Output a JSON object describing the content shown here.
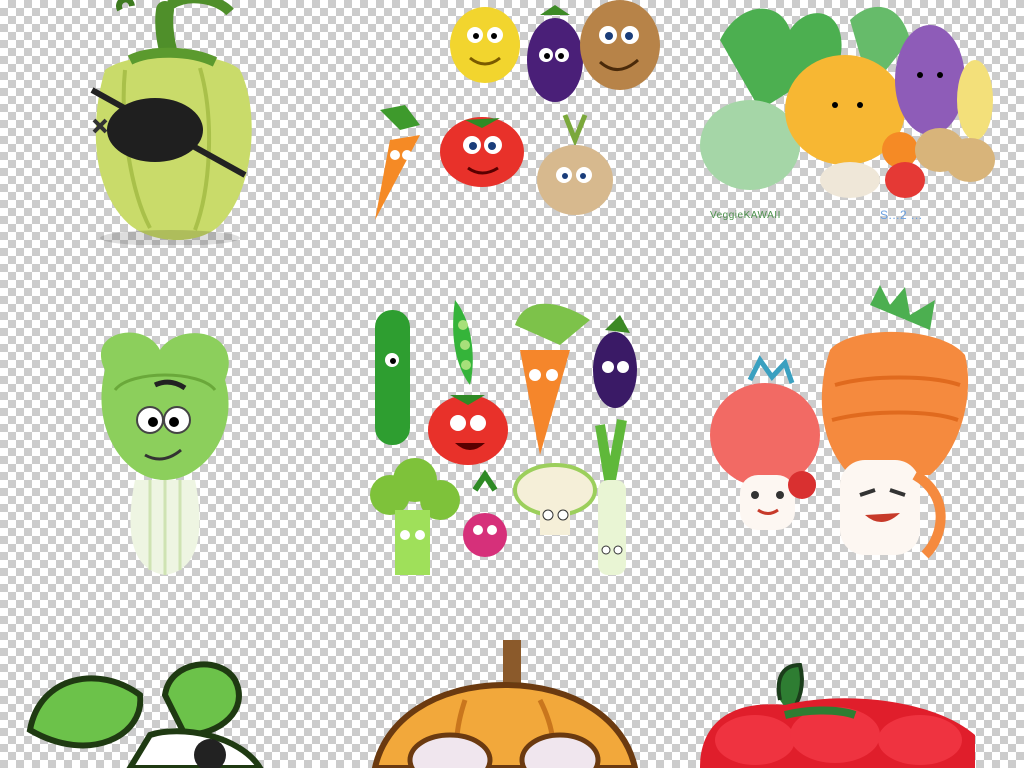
{
  "collage": {
    "items": [
      {
        "icon": "pirate-bell-pepper-icon"
      },
      {
        "icon": "vegetable-friends-group-icon"
      },
      {
        "icon": "kawaii-vegetable-pile-icon"
      },
      {
        "icon": "bok-choy-character-icon"
      },
      {
        "icon": "vegetable-characters-set-icon"
      },
      {
        "icon": "radish-carrot-characters-icon"
      },
      {
        "icon": "green-leaf-character-icon"
      },
      {
        "icon": "pumpkin-character-icon"
      },
      {
        "icon": "red-pepper-character-icon"
      }
    ],
    "watermark_left": "VeggieKAWAII",
    "watermark_right": "S...2 ...",
    "colors": {
      "checker_light": "#ffffff",
      "checker_dark": "#cccccc",
      "red": "#e53935",
      "orange": "#f5862b",
      "green": "#5fb83a",
      "purple": "#5b2a86",
      "yellow": "#f7d23b"
    }
  }
}
